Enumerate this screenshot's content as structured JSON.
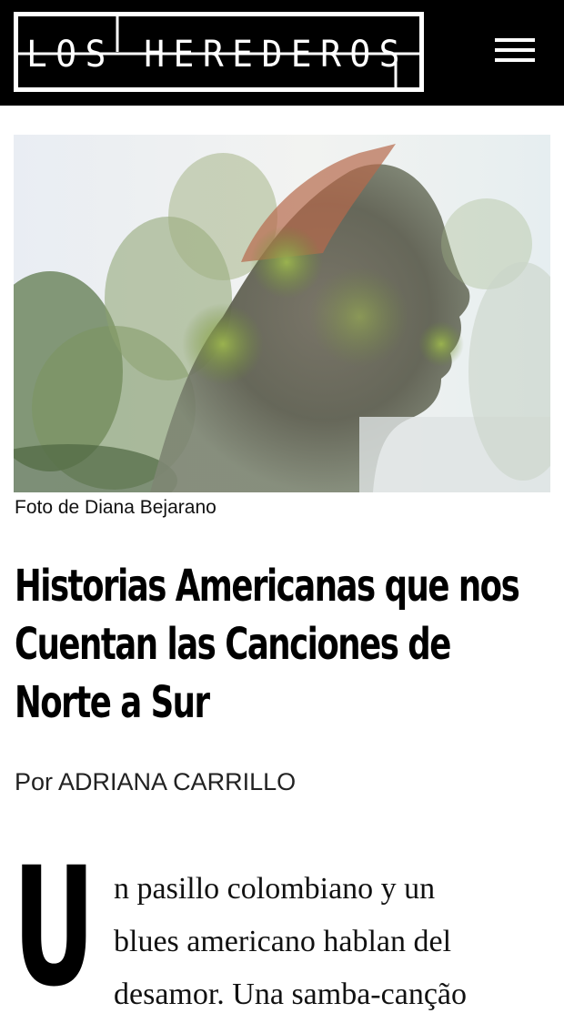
{
  "header": {
    "logo_text": "LOS HEREDEROS",
    "logo_icon": "los-herederos-logo",
    "menu_icon": "hamburger-menu-icon",
    "background_color": "#000000"
  },
  "hero": {
    "image_icon": "double-exposure-portrait-photo",
    "caption": "Foto de Diana Bejarano"
  },
  "article": {
    "title": "Historias Americanas que nos Cuentan las Canciones de Norte a Sur",
    "title_lines": [
      "Historias Americanas que nos",
      "Cuentan las Canciones de",
      "Norte a Sur"
    ],
    "byline": "Por ADRIANA CARRILLO",
    "drop_cap": "U",
    "body_lines": [
      "n pasillo colombiano y un",
      "blues americano hablan del",
      "desamor. Una samba-canção"
    ]
  }
}
